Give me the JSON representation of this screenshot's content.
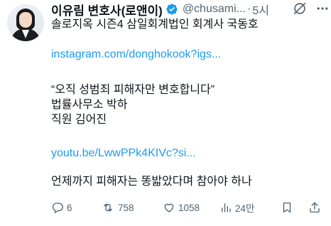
{
  "tweet": {
    "author_name": "이유림 변호사(로앤이)",
    "handle": "@chusami...",
    "separator": "·",
    "time": "5시",
    "lines": {
      "line1": "솔로지옥 시즌4 삼일회계법인 회계사 국동호",
      "link1": "instagram.com/donghokook?igs...",
      "quote": "“오직 성범죄 피해자만 변호합니다”",
      "firm": "법률사무소 박하",
      "staff": "직원 김어진",
      "link2": "youtu.be/LwwPPk4KIVc?si...",
      "closing": "언제까지 피해자는 똥밟았다며 참아야 하나"
    }
  },
  "actions": {
    "replies": "6",
    "retweets": "758",
    "likes": "1058",
    "views": "24만"
  },
  "icons": [
    "verified-badge-icon",
    "grok-icon",
    "more-icon",
    "reply-icon",
    "retweet-icon",
    "like-icon",
    "views-icon",
    "bookmark-icon",
    "share-icon"
  ],
  "colors": {
    "text": "#0f1419",
    "secondary": "#536471",
    "link": "#1d9bf0",
    "verified": "#1d9bf0"
  }
}
